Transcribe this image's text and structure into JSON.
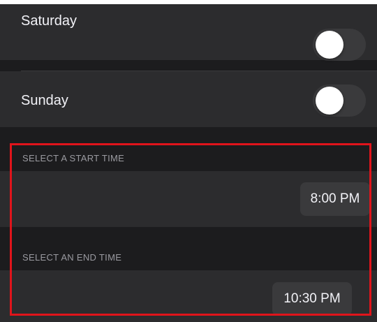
{
  "days": [
    {
      "label": "Saturday",
      "enabled": false
    },
    {
      "label": "Sunday",
      "enabled": false
    }
  ],
  "start_time": {
    "header": "SELECT A START TIME",
    "value": "8:00 PM"
  },
  "end_time": {
    "header": "SELECT AN END TIME",
    "value": "10:30 PM"
  },
  "colors": {
    "background": "#1c1c1e",
    "cell": "#2c2c2e",
    "toggle_off": "#3a3a3c",
    "highlight": "#e0141b"
  }
}
